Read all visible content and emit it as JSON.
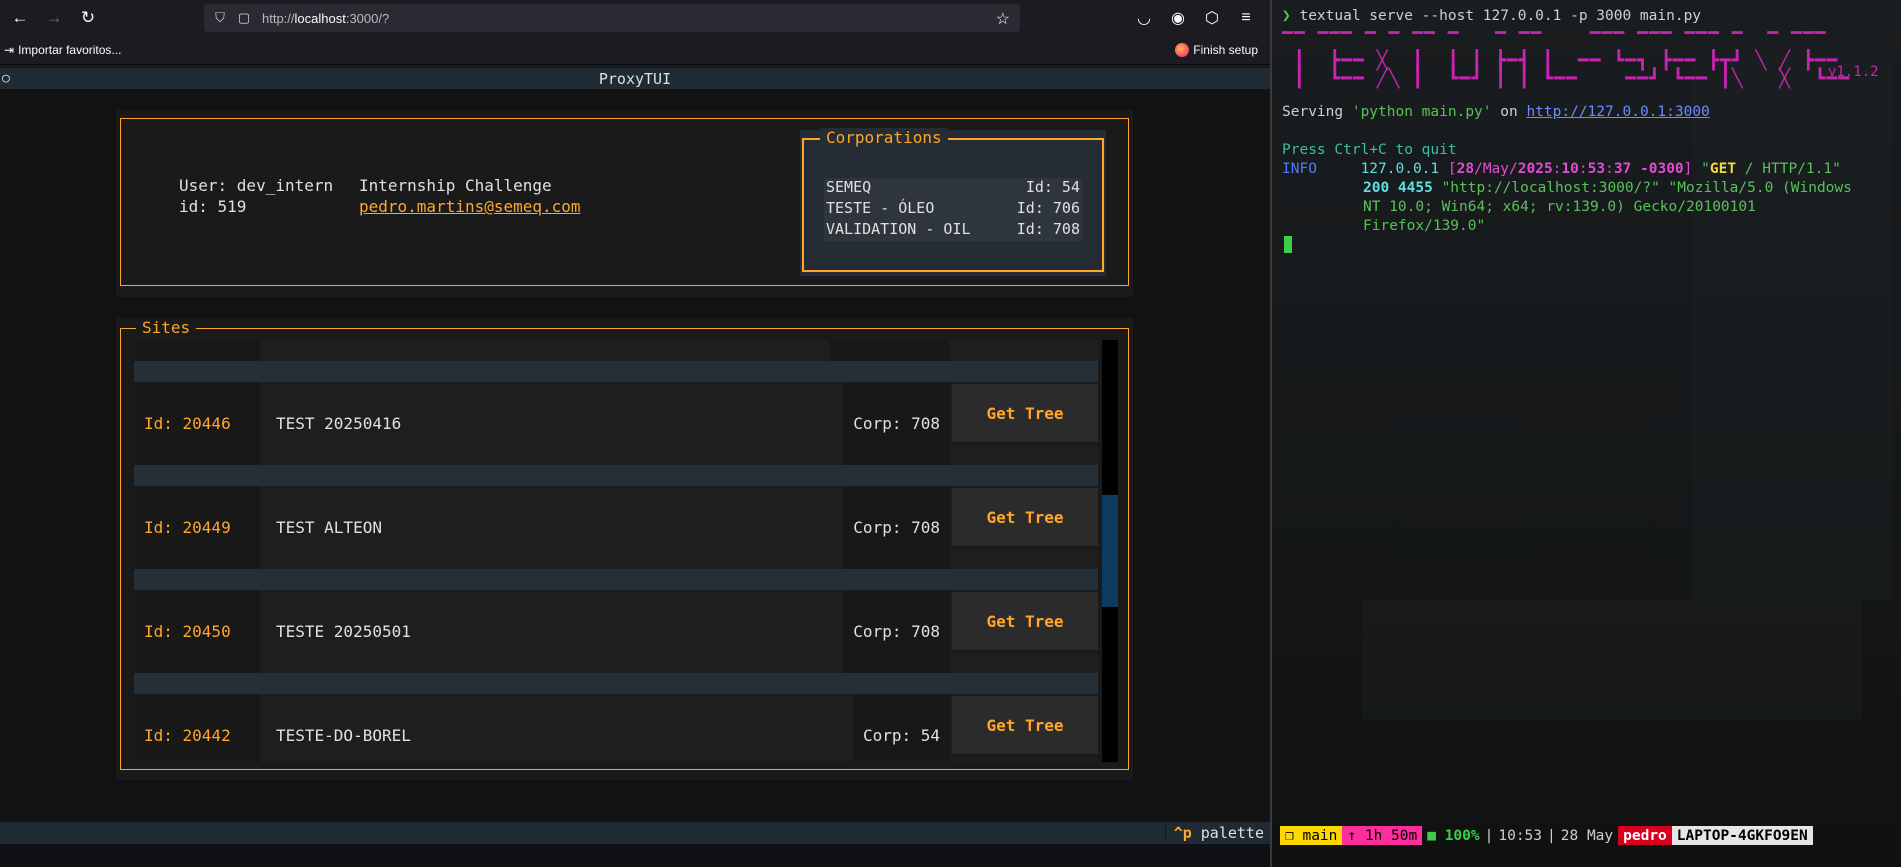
{
  "browser": {
    "url_prefix": "http://",
    "url_host": "localhost",
    "url_rest": ":3000/?",
    "bookmark_import": "Importar favoritos...",
    "finish_setup": "Finish setup"
  },
  "app": {
    "title": "ProxyTUI",
    "user": {
      "user_line": "User: dev_intern",
      "id_line": "id: 519",
      "company": "Internship Challenge",
      "email": "pedro.martins@semeq.com"
    },
    "corporations": {
      "title": "Corporations",
      "rows": [
        {
          "name": "SEMEQ",
          "id": "Id: 54"
        },
        {
          "name": "TESTE - ÓLEO",
          "id": "Id: 706"
        },
        {
          "name": "VALIDATION - OIL",
          "id": "Id: 708"
        }
      ]
    },
    "sites": {
      "title": "Sites",
      "rows": [
        {
          "id": "Id: 20446",
          "name": "TEST 20250416",
          "corp": "Corp: 708",
          "button": "Get Tree"
        },
        {
          "id": "Id: 20449",
          "name": "TEST ALTEON",
          "corp": "Corp: 708",
          "button": "Get Tree"
        },
        {
          "id": "Id: 20450",
          "name": "TESTE 20250501",
          "corp": "Corp: 708",
          "button": "Get Tree"
        },
        {
          "id": "Id: 20442",
          "name": "TESTE-DO-BOREL",
          "corp": "Corp: 54",
          "button": "Get Tree"
        }
      ]
    },
    "footer": {
      "key": "^p",
      "label": "palette"
    }
  },
  "terminal": {
    "prompt": "❯",
    "command": "textual serve --host 127.0.0.1 -p 3000 main.py",
    "banner_version": "v1.1.2",
    "serving_prefix": "Serving ",
    "serving_cmd": "'python main.py'",
    "serving_on": " on ",
    "serving_url": "http://127.0.0.1:3000",
    "quit_hint": "Press Ctrl+C to quit",
    "log_level": "INFO",
    "log_ip": "127.0.0.1",
    "log_ts_open": "[",
    "log_day": "28",
    "log_mon": "/May/",
    "log_year": "2025",
    "log_time_sep1": ":",
    "log_h": "10",
    "log_m": "53",
    "log_s": "37",
    "log_tz": " -0300",
    "log_ts_close": "]",
    "log_q1": " \"",
    "log_method": "GET",
    "log_path": " / HTTP/1.1\"",
    "log_status": "200 4455",
    "log_cont1": " \"http://localhost:3000/?\" \"Mozilla/5.0 (Windows",
    "log_cont2": "NT 10.0; Win64; x64; rv:139.0) Gecko/20100101",
    "log_cont3": "Firefox/139.0\"",
    "status": {
      "branch": "main",
      "uptime": "↑ 1h 50m",
      "battery": "100%",
      "time": "10:53",
      "date": "28 May",
      "user": "pedro",
      "host": "LAPTOP-4GKFO9EN",
      "sep": "|"
    },
    "colors": {
      "accent": "#ffa62b",
      "banner": "#c724b1",
      "branch_bg": "#ffd700",
      "uptime_bg": "#ff2d9b",
      "user_bg": "#d7001f"
    }
  }
}
